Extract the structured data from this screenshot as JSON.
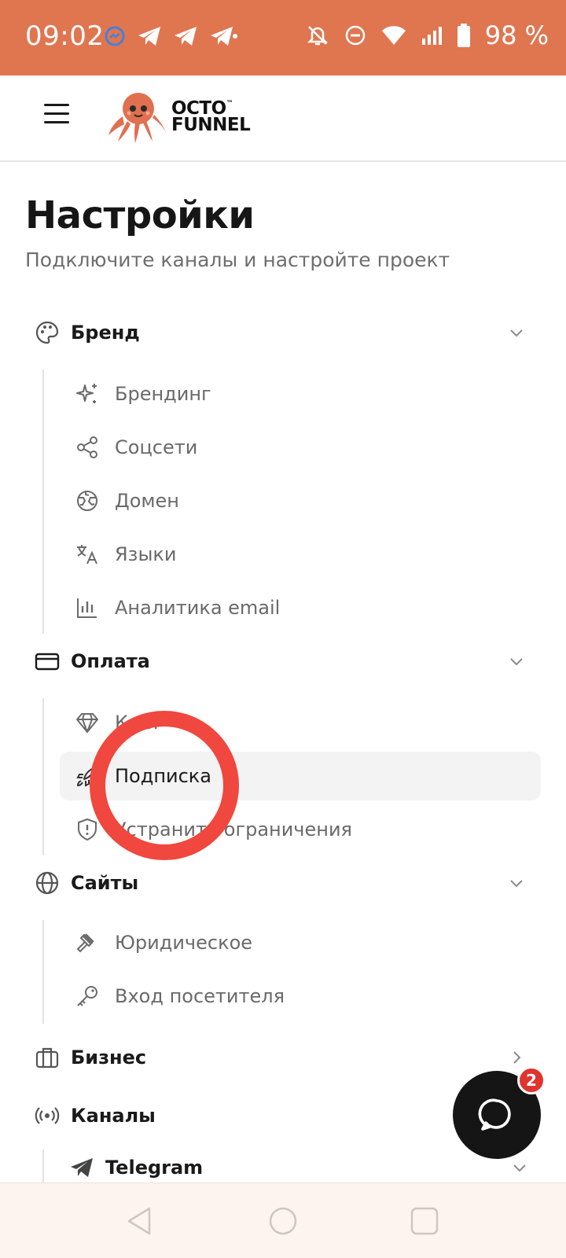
{
  "status_bar": {
    "time": "09:02",
    "battery_text": "98 %",
    "left_icons": [
      "messenger-icon",
      "telegram-icon",
      "telegram-icon",
      "telegram-icon"
    ],
    "right_icons": [
      "bell-off-icon",
      "do-not-disturb-icon",
      "wifi-icon",
      "signal-icon",
      "battery-icon"
    ]
  },
  "header": {
    "logo_line1": "OCTO",
    "logo_tm": "™",
    "logo_line2": "FUNNEL"
  },
  "page": {
    "title": "Настройки",
    "subtitle": "Подключите каналы и настройте проект"
  },
  "sections": {
    "brand": {
      "label": "Бренд",
      "items": [
        {
          "label": "Брендинг",
          "icon": "sparkles-icon"
        },
        {
          "label": "Соцсети",
          "icon": "share-icon"
        },
        {
          "label": "Домен",
          "icon": "globe-grid-icon"
        },
        {
          "label": "Языки",
          "icon": "translate-icon"
        },
        {
          "label": "Аналитика email",
          "icon": "bar-chart-icon"
        }
      ]
    },
    "payment": {
      "label": "Оплата",
      "items": [
        {
          "label": "К...и",
          "icon": "diamond-icon"
        },
        {
          "label": "Подписка",
          "icon": "rocket-icon",
          "active": true
        },
        {
          "label": "Устранить ограничения",
          "icon": "shield-alert-icon"
        }
      ]
    },
    "sites": {
      "label": "Сайты",
      "items": [
        {
          "label": "Юридическое",
          "icon": "gavel-icon"
        },
        {
          "label": "Вход посетителя",
          "icon": "key-icon"
        }
      ]
    },
    "business": {
      "label": "Бизнес"
    },
    "channels": {
      "label": "Каналы",
      "sub": {
        "label": "Telegram"
      }
    }
  },
  "chat": {
    "badge_count": "2"
  },
  "colors": {
    "status_bar": "#df7650",
    "accent_red": "#f0473e",
    "fab": "#151515",
    "badge": "#e0342e"
  }
}
